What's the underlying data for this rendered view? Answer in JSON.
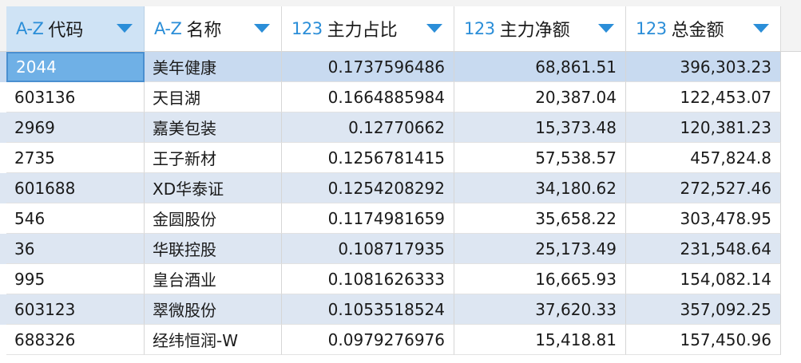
{
  "columns": [
    {
      "type_tag": "A-Z",
      "label": "代码"
    },
    {
      "type_tag": "A-Z",
      "label": "名称"
    },
    {
      "type_tag": "123",
      "label": "主力占比"
    },
    {
      "type_tag": "123",
      "label": "主力净额"
    },
    {
      "type_tag": "123",
      "label": "总金额"
    }
  ],
  "rows": [
    [
      "2044",
      "美年健康",
      "0.1737596486",
      "68,861.51",
      "396,303.23"
    ],
    [
      "603136",
      "天目湖",
      "0.1664885984",
      "20,387.04",
      "122,453.07"
    ],
    [
      "2969",
      "嘉美包装",
      "0.12770662",
      "15,373.48",
      "120,381.23"
    ],
    [
      "2735",
      "王子新材",
      "0.1256781415",
      "57,538.57",
      "457,824.8"
    ],
    [
      "601688",
      "XD华泰证",
      "0.1254208292",
      "34,180.62",
      "272,527.46"
    ],
    [
      "546",
      "金圆股份",
      "0.1174981659",
      "35,658.22",
      "303,478.95"
    ],
    [
      "36",
      "华联控股",
      "0.108717935",
      "25,173.49",
      "231,548.64"
    ],
    [
      "995",
      "皇台酒业",
      "0.1081626333",
      "16,665.93",
      "154,082.14"
    ],
    [
      "603123",
      "翠微股份",
      "0.1053518524",
      "37,620.33",
      "357,092.25"
    ],
    [
      "688326",
      "经纬恒润-W",
      "0.0979276976",
      "15,418.81",
      "157,450.96"
    ]
  ],
  "colors": {
    "type_tag": "#2b8ed8",
    "alt_row": "#dde6f2",
    "selected_row": "#c8daf0",
    "active_cell": "#6fb0e6",
    "selected_header": "#cfe3f5"
  },
  "icons": {
    "sort": "triangle-down",
    "type_text": "A-Z",
    "type_number": "123"
  }
}
